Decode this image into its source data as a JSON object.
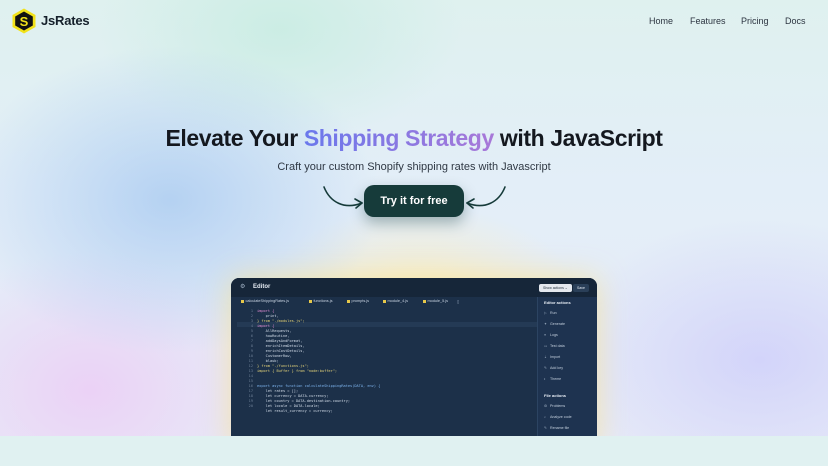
{
  "header": {
    "brand": "JsRates",
    "nav": [
      "Home",
      "Features",
      "Pricing",
      "Docs"
    ]
  },
  "hero": {
    "title_before": "Elevate Your ",
    "title_highlight": "Shipping Strategy",
    "title_after": " with JavaScript",
    "subtitle": "Craft your custom Shopify shipping rates with Javascript",
    "cta_label": "Try it for free"
  },
  "editor": {
    "title": "Editor",
    "show_actions_label": "Show actions ⌄",
    "save_label": "Save",
    "tabs": [
      "calculateShippingRates.js",
      "functions.js",
      "prompts.js",
      "module_4.js",
      "module_5.js"
    ],
    "line_numbers": [
      "1",
      "2",
      "3",
      "4",
      "5",
      "6",
      "7",
      "8",
      "9",
      "10",
      "11",
      "12",
      "13",
      "14",
      "15",
      "16",
      "17",
      "18",
      "19",
      "20"
    ],
    "code_lines": [
      "import {",
      "    print,",
      "} from \"./modules.js\";",
      "import {",
      "    AllRequests,",
      "    howRoutine,",
      "    addDaysAndFormat,",
      "    enrichItemDetails,",
      "    enrichCostDetails,",
      "    CustomerRow,",
      "    blaub;",
      "} from \"./functions.js\";",
      "import { Buffer } from \"node:buffer\";",
      "",
      "",
      "export async function calculateShippingRates(DATA, env) {",
      "    let rates = [];",
      "    let currency = DATA.currency;",
      "    let country = DATA.destination.country;",
      "    let locale = DATA.locale;",
      "    let result_currency = currency;"
    ],
    "editor_actions_heading": "Editor actions",
    "editor_actions": [
      {
        "icon": "▷",
        "label": "Run"
      },
      {
        "icon": "✦",
        "label": "Generate"
      },
      {
        "icon": "≡",
        "label": "Logs"
      },
      {
        "icon": "▭",
        "label": "Test data"
      },
      {
        "icon": "⇣",
        "label": "Import"
      },
      {
        "icon": "✎",
        "label": "Add key"
      },
      {
        "icon": "◐",
        "label": "Theme"
      }
    ],
    "file_actions_heading": "File actions",
    "file_actions": [
      {
        "icon": "⚙",
        "label": "Problems"
      },
      {
        "icon": "⌕",
        "label": "Analyze code"
      },
      {
        "icon": "✎",
        "label": "Rename file"
      }
    ]
  }
}
